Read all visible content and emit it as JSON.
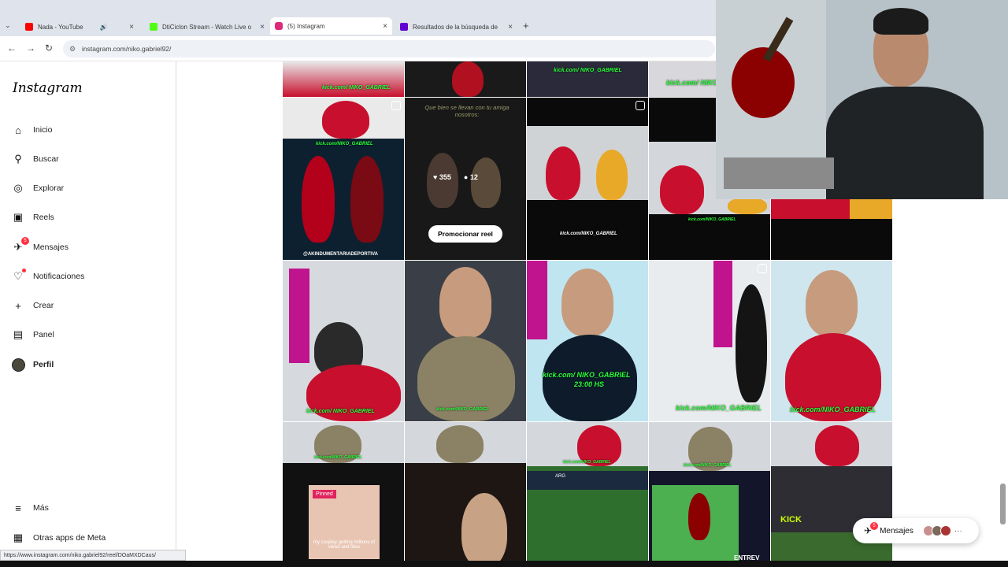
{
  "browser": {
    "tabs": [
      {
        "label": "Nada - YouTube",
        "color": "#ff0000"
      },
      {
        "label": "DtiCiclon Stream - Watch Live o",
        "color": "#53fc18"
      },
      {
        "label": "(5) Instagram",
        "color": "#dd2a7b"
      },
      {
        "label": "Resultados de la búsqueda de",
        "color": "#6001d2"
      }
    ],
    "url": "instagram.com/niko.gabriel92/",
    "status_url": "https://www.instagram.com/niko.gabriel92/reel/DOaMXDCaus/"
  },
  "sidebar": {
    "logo": "Instagram",
    "items": [
      {
        "label": "Inicio",
        "icon": "home-icon"
      },
      {
        "label": "Buscar",
        "icon": "search-icon"
      },
      {
        "label": "Explorar",
        "icon": "compass-icon"
      },
      {
        "label": "Reels",
        "icon": "reels-icon"
      },
      {
        "label": "Mensajes",
        "icon": "messenger-icon",
        "badge": "5"
      },
      {
        "label": "Notificaciones",
        "icon": "heart-icon"
      },
      {
        "label": "Crear",
        "icon": "plus-icon"
      },
      {
        "label": "Panel",
        "icon": "chart-icon"
      },
      {
        "label": "Perfil",
        "icon": "avatar-icon"
      }
    ],
    "more": "Más",
    "meta": "Otras apps de Meta"
  },
  "grid": {
    "kick_tag": "kick.com/NIKO_GABRIEL",
    "kick_tag_alt": "kick.com/ NIKO_GABRIEL",
    "kick_tag_big": "kick.com/ NIKO_GABRIEL",
    "time_tag": "23:00 HS",
    "hover_caption": "Que bien se llevan con tu amiga nosotros:",
    "likes": "355",
    "comments": "12",
    "promote": "Promocionar reel",
    "pinned": "Pinned",
    "pinned_caption": "my cosplay getting millions of views and likes",
    "credit": "@AKINDUMENTARIADEPORTIVA",
    "football_score": "ARG",
    "kick_banner": "KICK",
    "bottom_text": "ENTREV"
  },
  "messages_pill": {
    "label": "Mensajes",
    "badge": "5"
  }
}
